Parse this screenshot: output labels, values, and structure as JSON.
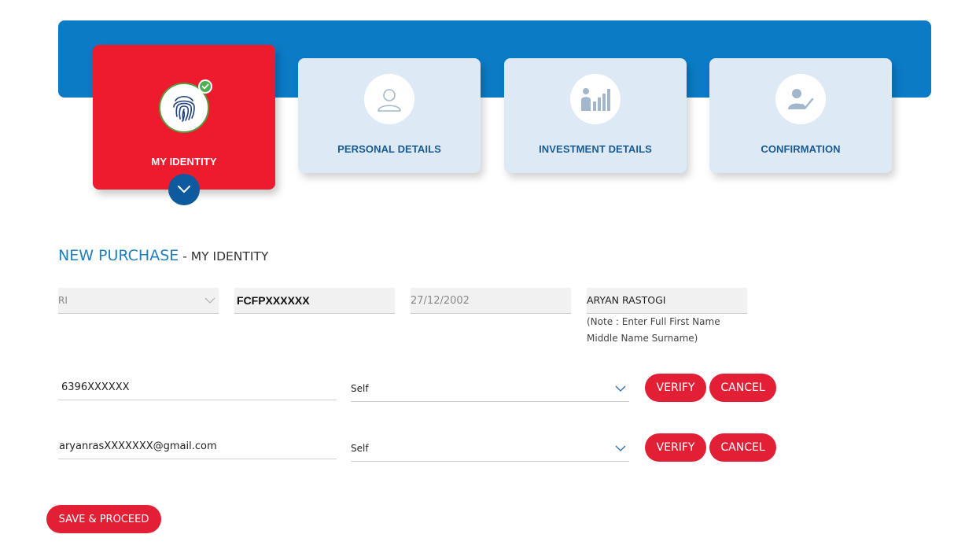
{
  "steps": [
    {
      "label": "MY IDENTITY",
      "icon": "fingerprint-icon",
      "state": "active",
      "completed": true
    },
    {
      "label": "PERSONAL DETAILS",
      "icon": "person-icon",
      "state": "inactive"
    },
    {
      "label": "INVESTMENT DETAILS",
      "icon": "investment-chart-icon",
      "state": "inactive"
    },
    {
      "label": "CONFIRMATION",
      "icon": "user-check-icon",
      "state": "inactive"
    }
  ],
  "page_title": {
    "main": "NEW PURCHASE",
    "sub": " - MY IDENTITY"
  },
  "identity": {
    "resident_status": "RI",
    "pan": "FCFPXXXXXX",
    "dob": "27/12/2002",
    "name": "ARYAN RASTOGI",
    "name_note": "(Note : Enter Full First Name Middle Name Surname)"
  },
  "mobile": {
    "value": "6396XXXXXX",
    "relation": "Self",
    "verify_label": "VERIFY",
    "cancel_label": "CANCEL"
  },
  "email": {
    "value": "aryanrasXXXXXXX@gmail.com",
    "relation": "Self",
    "verify_label": "VERIFY",
    "cancel_label": "CANCEL"
  },
  "save_label": "SAVE & PROCEED",
  "colors": {
    "banner": "#0b7bc6",
    "active_step": "#ed1b2e",
    "inactive_step": "#dde9f5",
    "button": "#e21f35",
    "title": "#1d7fc0"
  }
}
